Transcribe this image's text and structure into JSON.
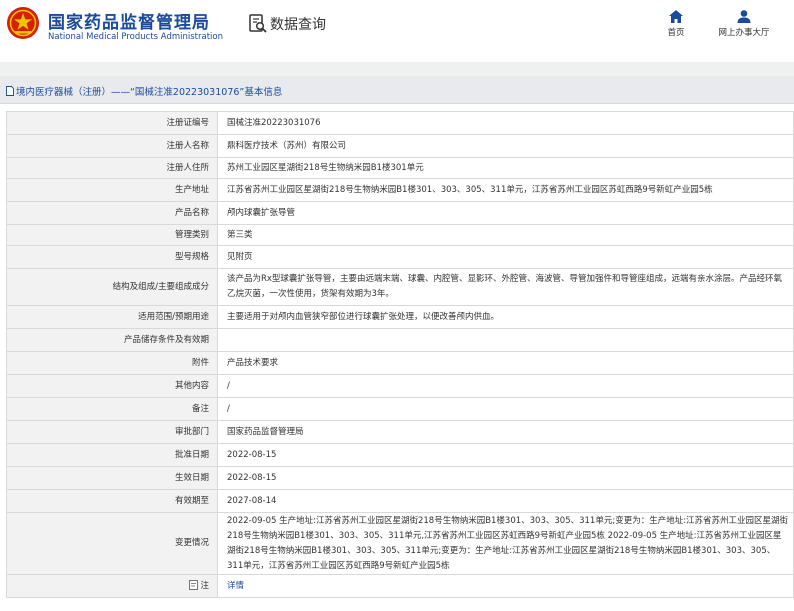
{
  "header": {
    "org_cn": "国家药品监督管理局",
    "org_en": "National Medical Products Administration",
    "query_title": "数据查询",
    "nav": {
      "home_label": "首页",
      "hall_label": "网上办事大厅"
    }
  },
  "breadcrumb": "境内医疗器械（注册）——“国械注准20223031076”基本信息",
  "rows": [
    {
      "label": "注册证编号",
      "value": "国械注准20223031076"
    },
    {
      "label": "注册人名称",
      "value": "鼎科医疗技术（苏州）有限公司"
    },
    {
      "label": "注册人住所",
      "value": "苏州工业园区星湖街218号生物纳米园B1楼301单元"
    },
    {
      "label": "生产地址",
      "value": "江苏省苏州工业园区星湖街218号生物纳米园B1楼301、303、305、311单元，江苏省苏州工业园区苏虹西路9号新虹产业园5栋"
    },
    {
      "label": "产品名称",
      "value": "颅内球囊扩张导管"
    },
    {
      "label": "管理类别",
      "value": "第三类"
    },
    {
      "label": "型号规格",
      "value": "见附页"
    },
    {
      "label": "结构及组成/主要组成成分",
      "value": "该产品为Rx型球囊扩张导管，主要由远端末端、球囊、内腔管、显影环、外腔管、海波管、导管加强件和导管座组成，远端有亲水涂层。产品经环氧乙烷灭菌，一次性使用，货架有效期为3年。"
    },
    {
      "label": "适用范围/预期用途",
      "value": "主要适用于对颅内血管狭窄部位进行球囊扩张处理，以便改善颅内供血。"
    },
    {
      "label": "产品储存条件及有效期",
      "value": ""
    },
    {
      "label": "附件",
      "value": "产品技术要求"
    },
    {
      "label": "其他内容",
      "value": "/"
    },
    {
      "label": "备注",
      "value": "/"
    },
    {
      "label": "审批部门",
      "value": "国家药品监督管理局"
    },
    {
      "label": "批准日期",
      "value": "2022-08-15"
    },
    {
      "label": "生效日期",
      "value": "2022-08-15"
    },
    {
      "label": "有效期至",
      "value": "2027-08-14"
    },
    {
      "label": "变更情况",
      "value": "2022-09-05 生产地址:江苏省苏州工业园区星湖街218号生物纳米园B1楼301、303、305、311单元;变更为：生产地址:江苏省苏州工业园区星湖街218号生物纳米园B1楼301、303、305、311单元,江苏省苏州工业园区苏虹西路9号新虹产业园5栋 2022-09-05 生产地址:江苏省苏州工业园区星湖街218号生物纳米园B1楼301、303、305、311单元;变更为：生产地址:江苏省苏州工业园区星湖街218号生物纳米园B1楼301、303、305、311单元，江苏省苏州工业园区苏虹西路9号新虹产业园5栋"
    },
    {
      "label": "注",
      "value": "详情"
    }
  ],
  "colors": {
    "brand_blue": "#1a4a9c",
    "label_bg": "#f2f2f2",
    "logo_red": "#d81e06",
    "logo_gold": "#f5c400"
  },
  "icons": [
    "emblem-logo",
    "search-doc-icon",
    "home-icon",
    "user-icon",
    "page-icon",
    "note-icon"
  ]
}
